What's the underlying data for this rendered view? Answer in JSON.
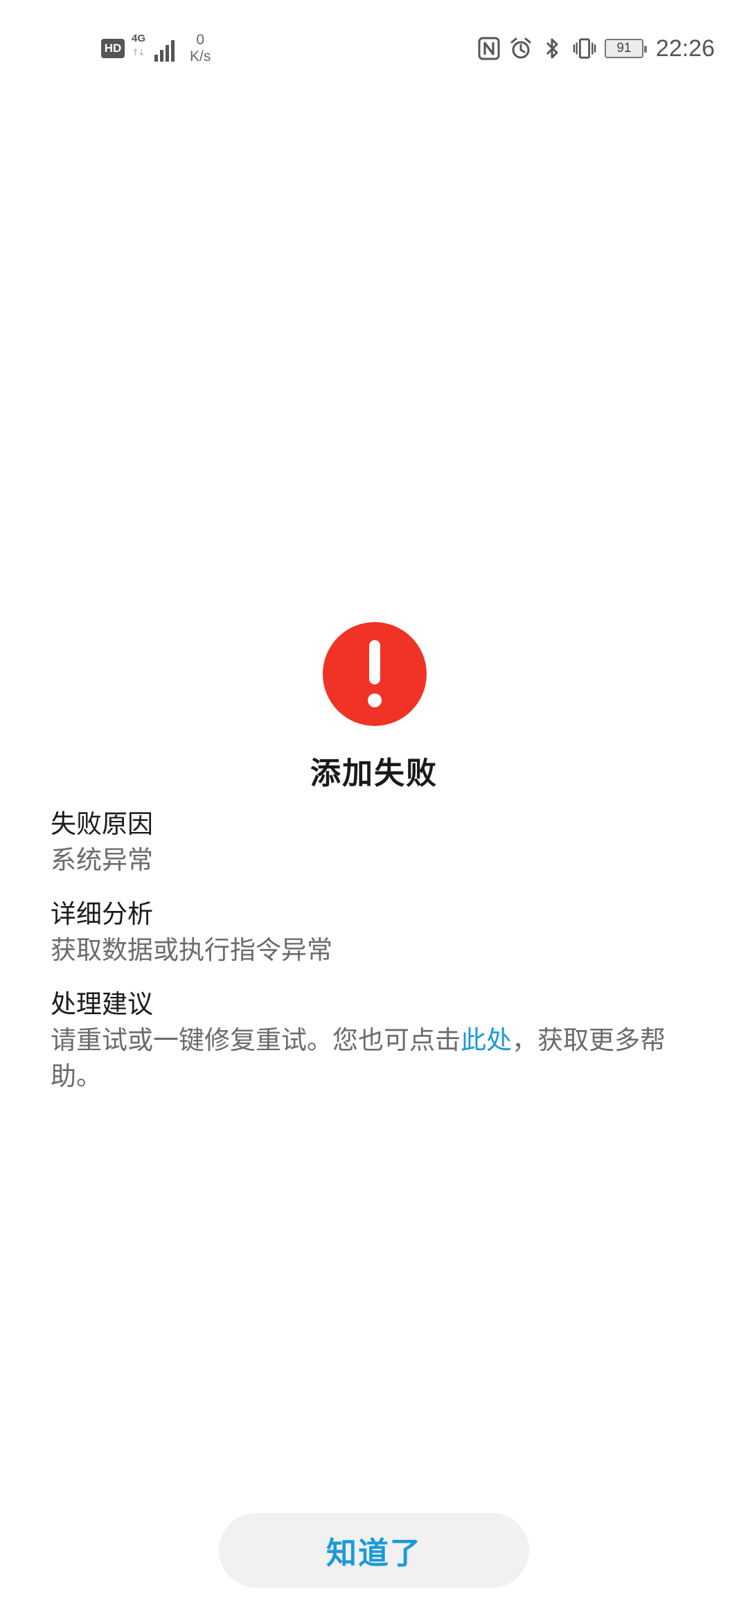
{
  "status_bar": {
    "hd_badge": "HD",
    "network_type": "4G",
    "speed_value": "0",
    "speed_unit": "K/s",
    "battery_level": "91",
    "time": "22:26",
    "icons": [
      "nfc-icon",
      "alarm-icon",
      "bluetooth-icon",
      "vibrate-icon",
      "battery-icon"
    ]
  },
  "dialog": {
    "icon": "error-exclamation-icon",
    "icon_color": "#f03324",
    "title": "添加失败",
    "reason_heading": "失败原因",
    "reason_text": "系统异常",
    "analysis_heading": "详细分析",
    "analysis_text": "获取数据或执行指令异常",
    "advice_heading": "处理建议",
    "advice_text_before": "请重试或一键修复重试。您也可点击",
    "advice_link": "此处",
    "advice_text_after": "，获取更多帮助。",
    "link_color": "#1a9ad9"
  },
  "footer": {
    "ok_button_label": "知道了"
  }
}
